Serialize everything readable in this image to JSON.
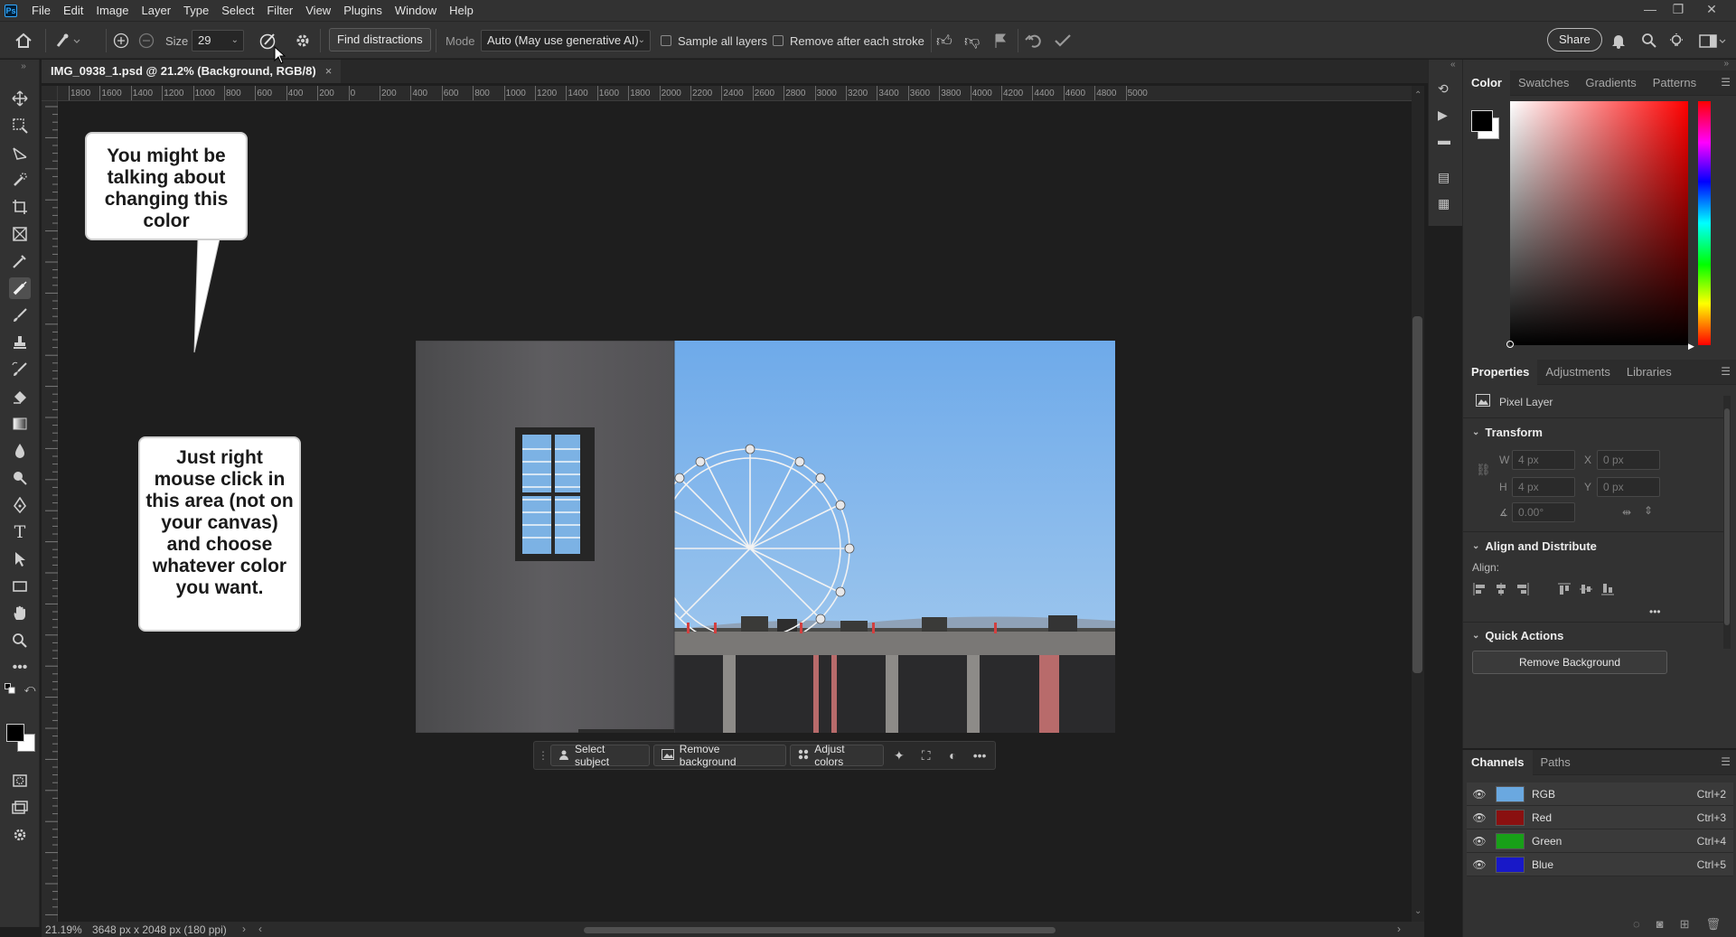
{
  "app": {
    "logo_text": "Ps"
  },
  "menu": [
    "File",
    "Edit",
    "Image",
    "Layer",
    "Type",
    "Select",
    "Filter",
    "View",
    "Plugins",
    "Window",
    "Help"
  ],
  "window_controls": {
    "minimize": "—",
    "restore": "❐",
    "close": "✕"
  },
  "options": {
    "size_label": "Size",
    "size_value": "29",
    "find_distractions": "Find distractions",
    "mode_label": "Mode",
    "mode_value": "Auto (May use generative AI)",
    "sample_all_layers": "Sample all layers",
    "remove_after_stroke": "Remove after each stroke",
    "share": "Share"
  },
  "document": {
    "tab_title": "IMG_0938_1.psd @ 21.2% (Background, RGB/8)",
    "tab_close": "×"
  },
  "ruler": {
    "h_ticks": [
      "1800",
      "1600",
      "1400",
      "1200",
      "1000",
      "800",
      "600",
      "400",
      "200",
      "0",
      "200",
      "400",
      "600",
      "800",
      "1000",
      "1200",
      "1400",
      "1600",
      "1800",
      "2000",
      "2200",
      "2400",
      "2600",
      "2800",
      "3000",
      "3200",
      "3400",
      "3600",
      "3800",
      "4000",
      "4200",
      "4400",
      "4600",
      "4800",
      "5000"
    ]
  },
  "callouts": {
    "top": "You might be talking about changing this color",
    "bottom": "Just right mouse click in this area (not on your canvas) and choose whatever color you want."
  },
  "contextual_bar": {
    "select_subject": "Select subject",
    "remove_background": "Remove background",
    "adjust_colors": "Adjust colors"
  },
  "status": {
    "zoom": "21.19%",
    "doc_info": "3648 px x 2048 px (180 ppi)"
  },
  "color_panel": {
    "tabs": [
      "Color",
      "Swatches",
      "Gradients",
      "Patterns"
    ],
    "hue": "#ff0000"
  },
  "properties_panel": {
    "tabs": [
      "Properties",
      "Adjustments",
      "Libraries"
    ],
    "layer_type": "Pixel Layer",
    "transform": {
      "title": "Transform",
      "w_label": "W",
      "w": "4 px",
      "x_label": "X",
      "x": "0 px",
      "h_label": "H",
      "h": "4 px",
      "y_label": "Y",
      "y": "0 px",
      "angle": "0.00°"
    },
    "align": {
      "title": "Align and Distribute",
      "label": "Align:"
    },
    "quick_actions": {
      "title": "Quick Actions",
      "remove_background": "Remove Background"
    }
  },
  "channels_panel": {
    "tabs": [
      "Channels",
      "Paths"
    ],
    "rows": [
      {
        "name": "RGB",
        "shortcut": "Ctrl+2",
        "color": "#6aa8e0"
      },
      {
        "name": "Red",
        "shortcut": "Ctrl+3",
        "color": "#8a1010"
      },
      {
        "name": "Green",
        "shortcut": "Ctrl+4",
        "color": "#18a018"
      },
      {
        "name": "Blue",
        "shortcut": "Ctrl+5",
        "color": "#1818c8"
      }
    ]
  },
  "colors": {
    "foreground": "#000000",
    "background": "#ffffff",
    "sky": "#7fb6ee"
  }
}
